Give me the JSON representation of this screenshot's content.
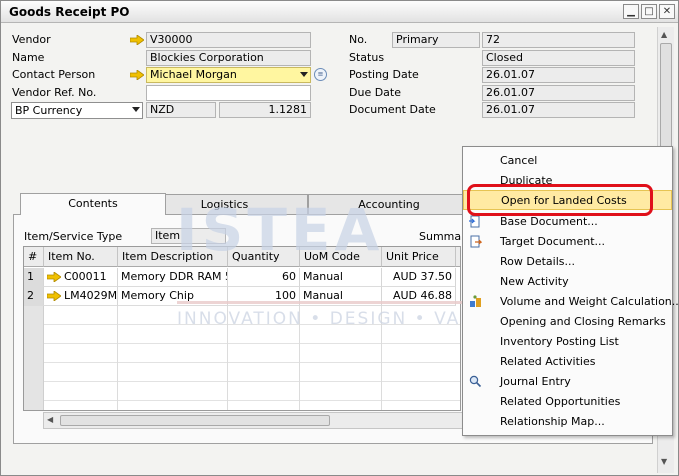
{
  "window": {
    "title": "Goods Receipt PO"
  },
  "header_left": {
    "vendor_label": "Vendor",
    "vendor_value": "V30000",
    "name_label": "Name",
    "name_value": "Blockies Corporation",
    "contact_label": "Contact Person",
    "contact_value": "Michael Morgan",
    "vendor_ref_label": "Vendor Ref. No.",
    "vendor_ref_value": "",
    "currency_select": "BP Currency",
    "currency_code": "NZD",
    "rate_value": "1.1281"
  },
  "header_right": {
    "no_label": "No.",
    "series_value": "Primary",
    "no_value": "72",
    "status_label": "Status",
    "status_value": "Closed",
    "posting_label": "Posting Date",
    "posting_value": "26.01.07",
    "due_label": "Due Date",
    "due_value": "26.01.07",
    "docdate_label": "Document Date",
    "docdate_value": "26.01.07"
  },
  "tabs": [
    {
      "label": "Contents",
      "active": true
    },
    {
      "label": "Logistics"
    },
    {
      "label": "Accounting"
    }
  ],
  "contents": {
    "item_service_label": "Item/Service Type",
    "item_service_value": "Item",
    "summary_label": "Summa",
    "columns": [
      "#",
      "Item No.",
      "Item Description",
      "Quantity",
      "UoM Code",
      "Unit Price",
      "I"
    ],
    "rows": [
      {
        "num": "1",
        "item_no": "C00011",
        "description": "Memory DDR RAM 5:",
        "quantity": "60",
        "uom": "Manual",
        "unit_price": "AUD 37.50"
      },
      {
        "num": "2",
        "item_no": "LM4029M(",
        "description": "Memory Chip",
        "quantity": "100",
        "uom": "Manual",
        "unit_price": "AUD 46.88"
      }
    ]
  },
  "watermark": {
    "main": "ISTEA",
    "tagline": "INNOVATION  •  DESIGN  •  VALUE"
  },
  "context_menu": {
    "items": [
      {
        "label": "Cancel",
        "icon": ""
      },
      {
        "label": "Duplicate",
        "icon": ""
      },
      {
        "label": "Open for Landed Costs",
        "icon": "",
        "highlighted": true
      },
      {
        "label": "Base Document...",
        "icon": "base-document-icon"
      },
      {
        "label": "Target Document...",
        "icon": "target-document-icon"
      },
      {
        "label": "Row Details...",
        "icon": ""
      },
      {
        "label": "New Activity",
        "icon": ""
      },
      {
        "label": "Volume and Weight Calculation...",
        "icon": "volume-weight-icon"
      },
      {
        "label": "Opening and Closing Remarks",
        "icon": ""
      },
      {
        "label": "Inventory Posting List",
        "icon": ""
      },
      {
        "label": "Related Activities",
        "icon": ""
      },
      {
        "label": "Journal Entry",
        "icon": "journal-entry-icon"
      },
      {
        "label": "Related Opportunities",
        "icon": ""
      },
      {
        "label": "Relationship Map...",
        "icon": ""
      }
    ]
  },
  "colors": {
    "highlight": "#ffeaa3",
    "annotation_ring": "#e0101a",
    "link_arrow": "#f0c000",
    "required_field": "#fff6a0"
  }
}
